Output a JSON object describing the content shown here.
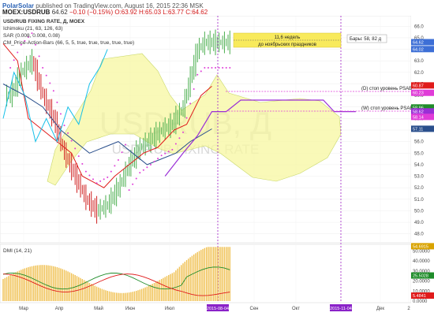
{
  "header": {
    "publisher": "PolarSolar",
    "published_text": "published on TradingView.com, August 16, 2015 22:36 MSK",
    "symbol": "MOEX:USDRUB",
    "last": "64.62",
    "change": "−0.10 (−0.15%)",
    "ohlc": "O:63.92 H:65.03 L:63.77 C:64.62"
  },
  "legend": {
    "title": "USD/RUB FIXING RATE, Д, MOEX",
    "ichimoku": "Ichimoku (21, 63, 126, 63)",
    "sar": "SAR (0.008, 0.008, 0.08)",
    "cm": "CM_Price-Action-Bars (66, 5, 5, true, true, true, true, true)"
  },
  "watermark": {
    "symbol": "USDRUB, Д",
    "name": "USD/RUB FIXING RATE"
  },
  "annotations": {
    "weeks_box_line1": "11,6 недель",
    "weeks_box_line2": "до ноябрьских праздников",
    "bars_box": "Бары: 58, 82 д",
    "stop_d": "(D) стоп уровень РЅАВ",
    "stop_w": "(W) стоп уровень РЅАВ"
  },
  "price_tags": [
    {
      "label": "64.62",
      "value": 64.62,
      "color": "#3d6fd6"
    },
    {
      "label": "64.02",
      "value": 64.02,
      "color": "#3d6fd6"
    },
    {
      "label": "60.87",
      "value": 60.87,
      "color": "#e01b1b"
    },
    {
      "label": "60.23",
      "value": 60.23,
      "color": "#e03cd8"
    },
    {
      "label": "58.96",
      "value": 58.96,
      "color": "#1f8c2a"
    },
    {
      "label": "58.62",
      "value": 58.62,
      "color": "#9a2fd6"
    },
    {
      "label": "58.14",
      "value": 58.14,
      "color": "#e03cd8"
    },
    {
      "label": "57.11",
      "value": 57.11,
      "color": "#2a4f8c"
    }
  ],
  "date_tags": [
    "2015-08-04",
    "2015-11-04"
  ],
  "dmi": {
    "title": "DMI (14, 21)",
    "tags": [
      {
        "label": "54.6915",
        "value": 54.6915,
        "color": "#d9a300"
      },
      {
        "label": "25.5028",
        "value": 25.5028,
        "color": "#1f8c2a"
      },
      {
        "label": "5.4841",
        "value": 5.4841,
        "color": "#e01b1b"
      }
    ]
  },
  "chart_data": {
    "type": "line",
    "title": "USD/RUB FIXING RATE, Д, MOEX",
    "x_labels": [
      "Мар",
      "Апр",
      "Май",
      "Июн",
      "Июл",
      "2015-08-04",
      "Сен",
      "Окт",
      "2015-11-04",
      "Дек",
      "2"
    ],
    "y_ticks": [
      48.0,
      49.0,
      50.0,
      51.0,
      52.0,
      53.0,
      54.0,
      55.0,
      56.0,
      57.0,
      58.0,
      59.0,
      60.0,
      61.0,
      62.0,
      63.0,
      64.0,
      65.0,
      66.0
    ],
    "ylim": [
      47.5,
      66.5
    ],
    "dmi_ticks": [
      "50.0000",
      "40.0000",
      "30.0000",
      "20.0000",
      "10.0000",
      "0.0000"
    ],
    "dmi_ylim": [
      0,
      55
    ],
    "series": [
      {
        "name": "Ichimoku tenkan",
        "color": "#e01b1b",
        "values": [
          [
            0,
            64.5
          ],
          [
            8,
            63
          ],
          [
            14,
            58
          ],
          [
            22,
            57
          ],
          [
            30,
            56
          ],
          [
            38,
            55
          ],
          [
            44,
            53
          ],
          [
            50,
            52.5
          ],
          [
            56,
            52
          ],
          [
            62,
            53
          ],
          [
            70,
            54
          ],
          [
            78,
            55
          ],
          [
            86,
            55.5
          ],
          [
            95,
            57
          ],
          [
            102,
            57.5
          ],
          [
            110,
            60
          ],
          [
            116,
            60.8
          ]
        ]
      },
      {
        "name": "Ichimoku kijun",
        "color": "#2a4f8c",
        "values": [
          [
            0,
            61
          ],
          [
            12,
            60
          ],
          [
            22,
            59
          ],
          [
            32,
            57
          ],
          [
            40,
            56
          ],
          [
            48,
            55
          ],
          [
            56,
            55.5
          ],
          [
            64,
            56
          ],
          [
            72,
            55
          ],
          [
            80,
            54
          ],
          [
            88,
            54.5
          ],
          [
            96,
            55
          ],
          [
            104,
            56
          ],
          [
            116,
            57.1
          ]
        ]
      },
      {
        "name": "Chikou",
        "color": "#17c0e8",
        "values": [
          [
            0,
            58
          ],
          [
            6,
            62
          ],
          [
            12,
            60
          ],
          [
            18,
            56
          ],
          [
            24,
            58
          ],
          [
            30,
            56
          ],
          [
            36,
            59
          ],
          [
            42,
            57.5
          ],
          [
            48,
            61
          ],
          [
            54,
            62.5
          ],
          [
            58,
            64
          ]
        ]
      },
      {
        "name": "Close",
        "color": "#4a9e3a",
        "values": [
          [
            4,
            60
          ],
          [
            10,
            62
          ],
          [
            16,
            63
          ],
          [
            22,
            60
          ],
          [
            28,
            58
          ],
          [
            34,
            55
          ],
          [
            40,
            53
          ],
          [
            46,
            51
          ],
          [
            52,
            50
          ],
          [
            58,
            50.5
          ],
          [
            64,
            52
          ],
          [
            70,
            54
          ],
          [
            76,
            55.5
          ],
          [
            82,
            56.2
          ],
          [
            88,
            57
          ],
          [
            94,
            57.5
          ],
          [
            100,
            59
          ],
          [
            104,
            61.5
          ],
          [
            108,
            64
          ],
          [
            112,
            64.6
          ]
        ]
      },
      {
        "name": "Projection",
        "color": "#9a2fd6",
        "values": [
          [
            90,
            53
          ],
          [
            100,
            55
          ],
          [
            108,
            56.5
          ],
          [
            116,
            58.6
          ],
          [
            124,
            58.6
          ],
          [
            132,
            59.6
          ],
          [
            150,
            59.6
          ],
          [
            166,
            59.6
          ],
          [
            178,
            59.6
          ],
          [
            184,
            58.6
          ],
          [
            196,
            58.6
          ]
        ]
      }
    ],
    "dmi_series": [
      {
        "name": "ADX",
        "color": "#d9a300"
      },
      {
        "name": "+DI",
        "color": "#1f8c2a"
      },
      {
        "name": "-DI",
        "color": "#e01b1b"
      }
    ]
  }
}
